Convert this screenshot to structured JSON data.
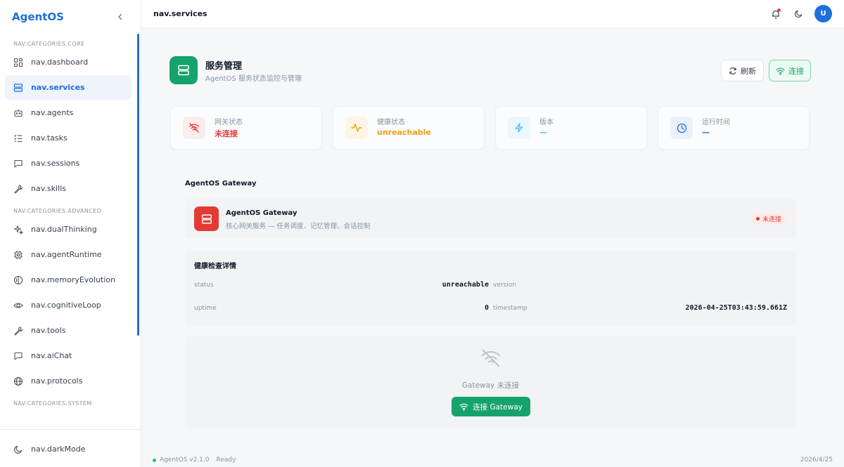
{
  "app": {
    "logo": "AgentOS"
  },
  "sidebar": {
    "core_label": "NAV.CATEGORIES.CORE",
    "core_items": [
      {
        "label": "nav.dashboard",
        "icon": "grid-icon"
      },
      {
        "label": "nav.services",
        "icon": "server-icon",
        "active": true
      },
      {
        "label": "nav.agents",
        "icon": "bot-icon"
      },
      {
        "label": "nav.tasks",
        "icon": "list-check-icon"
      },
      {
        "label": "nav.sessions",
        "icon": "chat-icon"
      },
      {
        "label": "nav.skills",
        "icon": "wrench-icon"
      }
    ],
    "advanced_label": "NAV.CATEGORIES.ADVANCED",
    "advanced_items": [
      {
        "label": "nav.dualThinking",
        "icon": "sparkles-icon"
      },
      {
        "label": "nav.agentRuntime",
        "icon": "cpu-icon"
      },
      {
        "label": "nav.memoryEvolution",
        "icon": "brain-icon"
      },
      {
        "label": "nav.cognitiveLoop",
        "icon": "eye-icon"
      },
      {
        "label": "nav.tools",
        "icon": "wrench-icon"
      },
      {
        "label": "nav.aiChat",
        "icon": "chat-icon"
      },
      {
        "label": "nav.protocols",
        "icon": "globe-icon"
      }
    ],
    "system_label": "NAV.CATEGORIES.SYSTEM",
    "footer_item": {
      "label": "nav.darkMode",
      "icon": "moon-icon"
    }
  },
  "topbar": {
    "breadcrumb": "nav.services",
    "avatar_initial": "U"
  },
  "page": {
    "title": "服务管理",
    "subtitle": "AgentOS 服务状态监控与管理",
    "refresh_label": "刷新",
    "connect_label": "连接"
  },
  "stats": [
    {
      "label": "网关状态",
      "value": "未连接",
      "color": "#e53935",
      "icon": "wifi-off-icon"
    },
    {
      "label": "健康状态",
      "value": "unreachable",
      "color": "#f59e0b",
      "icon": "activity-icon"
    },
    {
      "label": "版本",
      "value": "—",
      "color": "#38bdf8",
      "icon": "bolt-icon"
    },
    {
      "label": "运行时间",
      "value": "—",
      "color": "#1e6fd9",
      "icon": "clock-icon"
    }
  ],
  "gateway": {
    "section_title": "AgentOS Gateway",
    "name": "AgentOS Gateway",
    "description": "核心网关服务 — 任务调度、记忆管理、会话控制",
    "status_badge": "未连接"
  },
  "health": {
    "title": "健康检查详情",
    "rows": [
      {
        "key": "status",
        "value": "unreachable"
      },
      {
        "key": "version",
        "value": ""
      },
      {
        "key": "uptime",
        "value": "0"
      },
      {
        "key": "timestamp",
        "value": "2026-04-25T03:43:59.661Z"
      }
    ]
  },
  "empty_state": {
    "text": "Gateway 未连接",
    "button_label": "连接 Gateway"
  },
  "statusbar": {
    "version": "AgentOS v2.1.0",
    "state": "Ready",
    "date": "2026/4/25"
  }
}
